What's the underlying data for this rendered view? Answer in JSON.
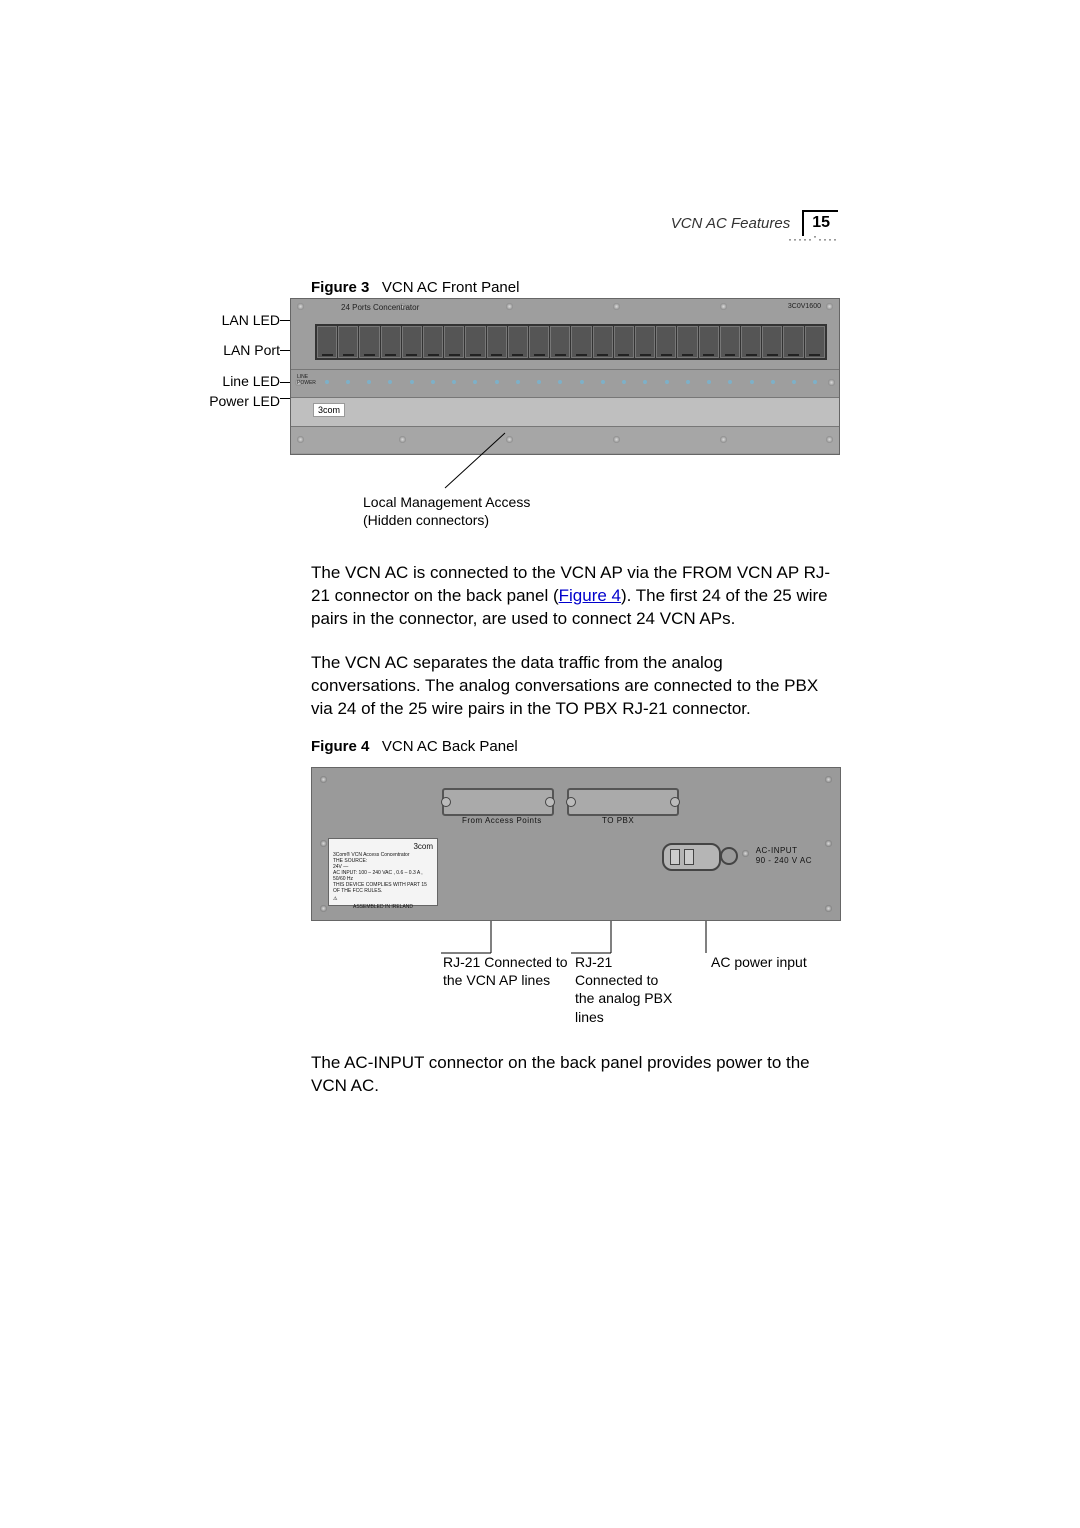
{
  "header": {
    "section": "VCN AC Features",
    "page_number": "15"
  },
  "figure3": {
    "prefix": "Figure 3",
    "title": "VCN AC Front Panel",
    "labels": {
      "lan_led": "LAN LED",
      "lan_port": "LAN Port",
      "line_led": "Line LED",
      "power_led": "Power LED"
    },
    "panel_title": "24 Ports Concentrator",
    "model": "3C0V1600",
    "row2_side1": "LINE",
    "row2_side2": "POWER",
    "logo": "3com",
    "callout": {
      "line1": "Local Management Access",
      "line2": "(Hidden connectors)"
    }
  },
  "para1": {
    "part1": "The VCN AC is connected to the VCN AP via the FROM VCN AP RJ-21 connector on the back panel (",
    "link": "Figure 4",
    "part2": "). The first 24 of the 25 wire pairs in the connector, are used to connect 24 VCN APs."
  },
  "para2": "The VCN AC separates the data traffic from the analog conversations. The analog conversations are connected to the PBX via 24 of the 25 wire pairs in the TO PBX RJ-21 connector.",
  "figure4": {
    "prefix": "Figure 4",
    "title": "VCN AC Back Panel",
    "conn1_label": "From Access Points",
    "conn2_label": "TO PBX",
    "ac_line1": "AC-INPUT",
    "ac_line2": "90 - 240 V AC",
    "info_brand": "3com",
    "info_text": "3Com® VCN Access Concentrator\nTHE SOURCE:\n24V —\nAC INPUT: 100 – 240 VAC , 0.6 – 0.3 A , 50/60 Hz\nTHIS DEVICE COMPLIES WITH PART 15\nOF THE FCC RULES.",
    "info_assembled": "ASSEMBLED IN IRELAND",
    "callouts": {
      "c1_l1": "RJ-21 Connected to",
      "c1_l2": "the VCN AP lines",
      "c2_l1": "RJ-21",
      "c2_l2": "Connected to",
      "c2_l3": "the analog PBX",
      "c2_l4": "lines",
      "c3": "AC power input"
    }
  },
  "para3": "The AC-INPUT connector on the back panel provides power to the VCN AC."
}
